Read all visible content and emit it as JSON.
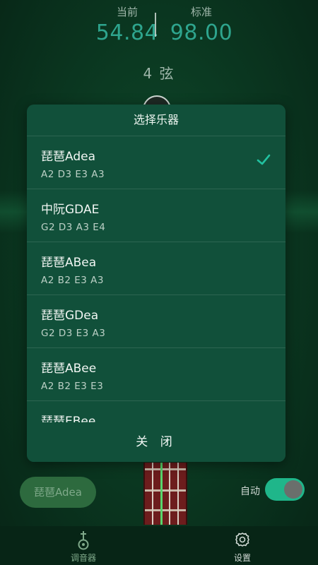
{
  "readout": {
    "current_label": "当前",
    "current_value": "54.84",
    "target_label": "标准",
    "target_value": "98.00"
  },
  "string_label": "4 弦",
  "modal": {
    "title": "选择乐器",
    "items": [
      {
        "name": "琵琶Adea",
        "notes": "A2  D3 E3  A3",
        "selected": true
      },
      {
        "name": "中阮GDAE",
        "notes": "G2  D3 A3  E4",
        "selected": false
      },
      {
        "name": "琵琶ABea",
        "notes": "A2  B2 E3  A3",
        "selected": false
      },
      {
        "name": "琵琶GDea",
        "notes": "G2 D3 E3  A3",
        "selected": false
      },
      {
        "name": "琵琶ABee",
        "notes": "A2  B2 E3  E3",
        "selected": false
      },
      {
        "name": "琵琶EBee",
        "notes": "",
        "selected": false
      }
    ],
    "close_label": "关 闭"
  },
  "controls": {
    "preset_label": "琵琶Adea",
    "auto_label": "自动",
    "auto_enabled": true
  },
  "nav": {
    "tuner_label": "调音器",
    "settings_label": "设置",
    "tuner_icon": "tuner-icon",
    "settings_icon": "gear-icon"
  },
  "colors": {
    "accent": "#2ea58e",
    "check": "#22c1a0",
    "toggle_on": "#1fb68a",
    "active_string": "#56d66c"
  }
}
